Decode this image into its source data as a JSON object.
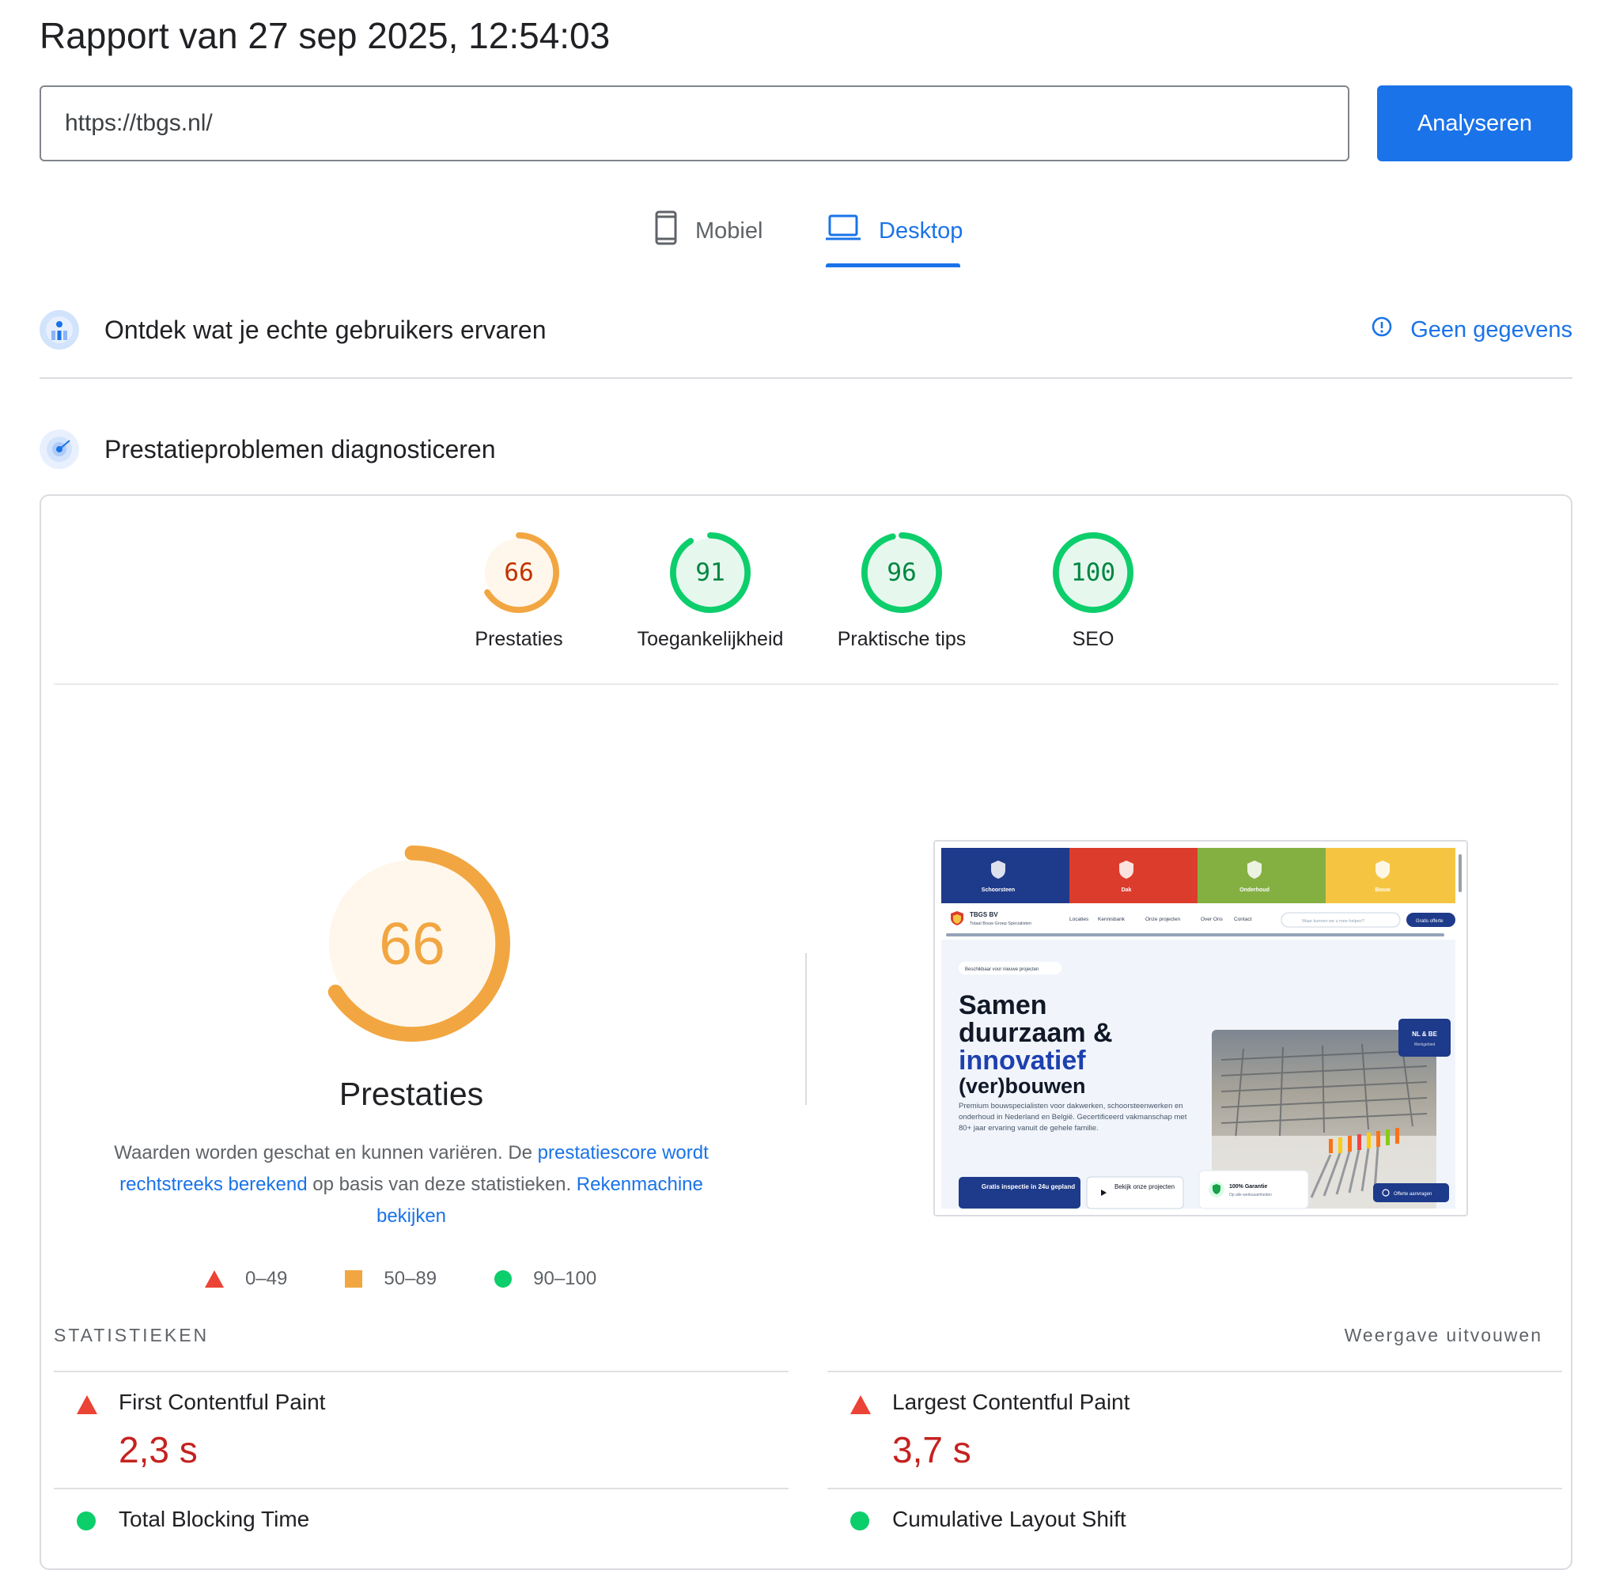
{
  "header": {
    "title": "Rapport van 27 sep 2025, 12:54:03"
  },
  "url_bar": {
    "value": "https://tbgs.nl/",
    "button_label": "Analyseren"
  },
  "tabs": [
    {
      "label": "Mobiel",
      "active": false
    },
    {
      "label": "Desktop",
      "active": true
    }
  ],
  "crux": {
    "title": "Ontdek wat je echte gebruikers ervaren",
    "status": "Geen gegevens"
  },
  "diagnostics": {
    "title": "Prestatieproblemen diagnosticeren"
  },
  "categories": [
    {
      "label": "Prestaties",
      "score": 66,
      "rating": "average"
    },
    {
      "label": "Toegankelijkheid",
      "score": 91,
      "rating": "pass"
    },
    {
      "label": "Praktische tips",
      "score": 96,
      "rating": "pass"
    },
    {
      "label": "SEO",
      "score": 100,
      "rating": "pass"
    }
  ],
  "performance": {
    "score": 66,
    "title": "Prestaties",
    "desc_1": "Waarden worden geschat en kunnen variëren. De ",
    "link_1": "prestatiescore wordt rechtstreeks berekend",
    "desc_2": " op basis van deze statistieken. ",
    "link_2": "Rekenmachine bekijken"
  },
  "legend": [
    {
      "range": "0–49",
      "shape": "triangle"
    },
    {
      "range": "50–89",
      "shape": "square"
    },
    {
      "range": "90–100",
      "shape": "circle"
    }
  ],
  "metrics": {
    "header": "STATISTIEKEN",
    "expand_label": "Weergave uitvouwen",
    "items": [
      {
        "name": "First Contentful Paint",
        "value": "2,3 s",
        "rating": "fail"
      },
      {
        "name": "Largest Contentful Paint",
        "value": "3,7 s",
        "rating": "fail"
      },
      {
        "name": "Total Blocking Time",
        "value": "",
        "rating": "pass"
      },
      {
        "name": "Cumulative Layout Shift",
        "value": "",
        "rating": "pass"
      }
    ]
  },
  "colors": {
    "accent": "#1a73e8",
    "fail": "#eb4335",
    "fail_text": "#c5221f",
    "average": "#f2a641",
    "average_text": "#c33300",
    "pass": "#0cce6b",
    "pass_text": "#018642"
  },
  "screenshot": {
    "topbar": [
      {
        "label": "Schoorsteen",
        "color": "#1e3a8a"
      },
      {
        "label": "Dak",
        "color": "#dc3c2c"
      },
      {
        "label": "Onderhoud",
        "color": "#84b042"
      },
      {
        "label": "Bouw",
        "color": "#f5c542"
      }
    ],
    "brand": "TBGS BV",
    "brand_sub": "Totaal Bouw Groep Specialisten",
    "nav": [
      "Locaties",
      "Kennisbank",
      "Onze projecten",
      "Over Ons",
      "Contact"
    ],
    "search_placeholder": "Waar kunnen we u mee helpen?",
    "cta_top": "Gratis offerte",
    "badge": "Beschikbaar voor nieuwe projecten",
    "hero_1": "Samen",
    "hero_2": "duurzaam &",
    "hero_3": "innovatief",
    "hero_4": "(ver)bouwen",
    "hero_text": "Premium bouwspecialisten voor dakwerken, schoorsteenwerken en onderhoud in Nederland en België. Gecertificeerd vakmanschap met 80+ jaar ervaring vanuit de gehele familie.",
    "btn_primary": "Gratis inspectie in 24u gepland",
    "btn_secondary": "Bekijk onze projecten",
    "guarantee": "100% Garantie",
    "guarantee_sub": "Op alle werkzaamheden",
    "region_badge": "NL & BE",
    "region_sub": "Werkgebied",
    "offer_btn": "Offerte aanvragen"
  }
}
